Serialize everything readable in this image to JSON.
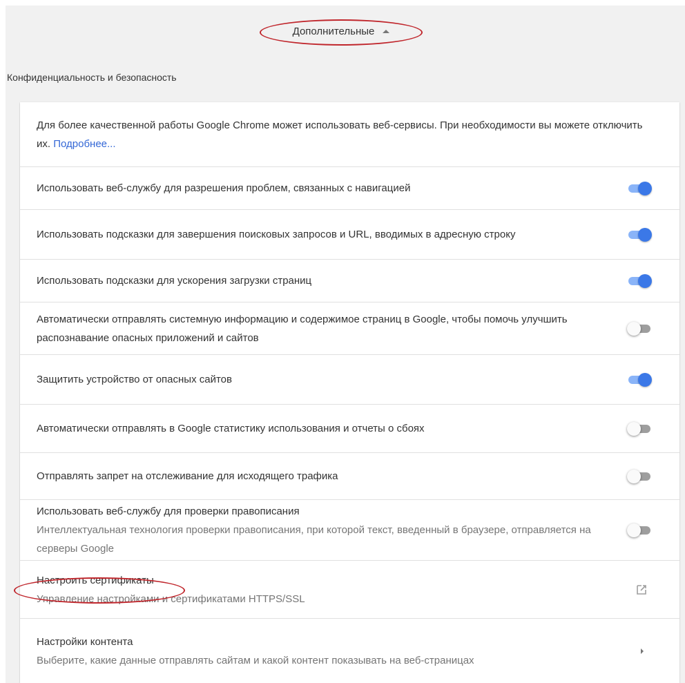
{
  "advanced": {
    "label": "Дополнительные",
    "icon": "caret-up-icon"
  },
  "section": {
    "title": "Конфиденциальность и безопасность"
  },
  "intro": {
    "text": "Для более качественной работы Google Chrome может использовать веб-сервисы. При необходимости вы можете отключить их.",
    "link": "Подробнее..."
  },
  "settings": [
    {
      "title": "Использовать веб-службу для разрешения проблем, связанных с навигацией",
      "state": true
    },
    {
      "title": "Использовать подсказки для завершения поисковых запросов и URL, вводимых в адресную строку",
      "state": true
    },
    {
      "title": "Использовать подсказки для ускорения загрузки страниц",
      "state": true
    },
    {
      "title": "Автоматически отправлять системную информацию и содержимое страниц в Google, чтобы помочь улучшить распознавание опасных приложений и сайтов",
      "state": false
    },
    {
      "title": "Защитить устройство от опасных сайтов",
      "state": true
    },
    {
      "title": "Автоматически отправлять в Google статистику использования и отчеты о сбоях",
      "state": false
    },
    {
      "title": "Отправлять запрет на отслеживание для исходящего трафика",
      "state": false
    },
    {
      "title": "Использовать веб-службу для проверки правописания",
      "subtitle": "Интеллектуальная технология проверки правописания, при которой текст, введенный в браузере, отправляется на серверы Google",
      "state": false
    }
  ],
  "certificates": {
    "title": "Настроить сертификаты",
    "subtitle": "Управление настройками и сертификатами HTTPS/SSL",
    "icon": "external-link-icon"
  },
  "content_settings": {
    "title": "Настройки контента",
    "subtitle": "Выберите, какие данные отправлять сайтам и какой контент показывать на веб-страницах",
    "icon": "chevron-right-icon"
  },
  "colors": {
    "toggle_on": "#3b78e7",
    "toggle_on_track": "#8ab4f8",
    "toggle_off_track": "#9e9e9e",
    "link": "#3367d6",
    "annotation": "#c0262c"
  }
}
